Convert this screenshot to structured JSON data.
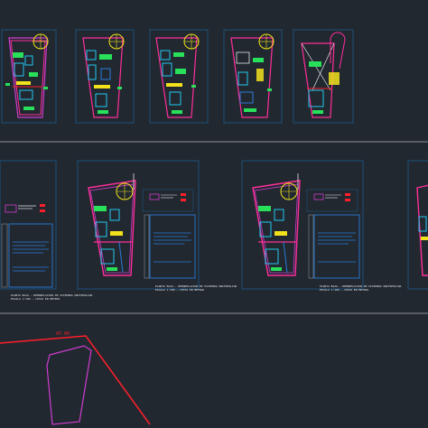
{
  "drawing": {
    "background": "#212830",
    "separator_color": "#8a8f95",
    "layer_colors": {
      "frame": "#1e4a6e",
      "wall": "#ff2e9a",
      "cyan": "#23c7f0",
      "green": "#29e05a",
      "yellow": "#f2e21b",
      "red": "#ff1f2a",
      "white": "#e8e8e8",
      "magenta": "#d03cd0",
      "blue": "#2a7bd8"
    },
    "top_sheet_count": 5,
    "middle_sheet_count": 4,
    "dimension_label": "47.00",
    "note_line_1": "PLANTA BAJA — REMODELACION DE VIVIENDA UNIFAMILIAR",
    "note_line_2": "ESCALA 1:100 — COTAS EN METROS"
  },
  "icons": {
    "stair_icon": "spiral-stair-icon"
  }
}
